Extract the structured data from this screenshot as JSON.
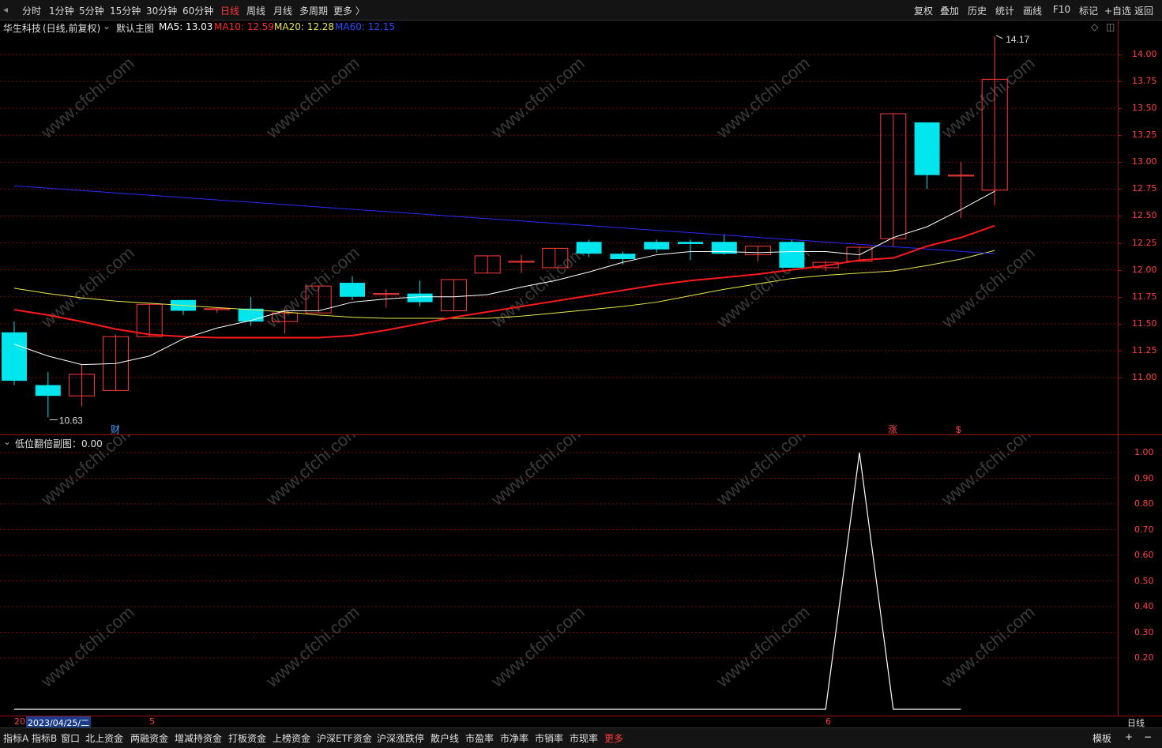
{
  "topbar": {
    "periods": [
      "分时",
      "1分钟",
      "5分钟",
      "15分钟",
      "30分钟",
      "60分钟",
      "日线",
      "周线",
      "月线",
      "多周期",
      "更多 〉"
    ],
    "active_period": "日线",
    "right_buttons": [
      "复权",
      "叠加",
      "历史",
      "统计",
      "画线",
      "F10",
      "标记",
      "+自选",
      "返回"
    ]
  },
  "main_chart": {
    "stock_name": "华生科技",
    "mode": "(日线,前复权)",
    "template": "默认主图",
    "ma5": "MA5: 13.03",
    "ma10": "MA10: 12.59",
    "ma20": "MA20: 12.28",
    "ma60": "MA60: 12.15",
    "y_labels": [
      "14.00",
      "13.75",
      "13.50",
      "13.25",
      "13.00",
      "12.75",
      "12.50",
      "12.25",
      "12.00",
      "11.75",
      "11.50",
      "11.25",
      "11.00"
    ],
    "high_label": "14.17",
    "low_label": "10.63",
    "markers": {
      "cai": "财",
      "zhang": "涨",
      "dollar": "$"
    },
    "colors": {
      "up": "#ff3b3b",
      "down": "#00e5ee",
      "ma5": "#ffffff",
      "ma10": "#ff1a1a",
      "ma20": "#e8e84a",
      "ma60": "#2a2aff",
      "grid": "#7a0a0a"
    }
  },
  "chart_data": {
    "type": "candlestick",
    "ylim": [
      10.6,
      14.3
    ],
    "candles": [
      {
        "o": 11.42,
        "h": 11.52,
        "l": 10.93,
        "c": 10.97
      },
      {
        "o": 10.93,
        "h": 11.05,
        "l": 10.63,
        "c": 10.83
      },
      {
        "o": 10.83,
        "h": 11.12,
        "l": 10.73,
        "c": 11.03
      },
      {
        "o": 10.88,
        "h": 11.4,
        "l": 10.88,
        "c": 11.38
      },
      {
        "o": 11.38,
        "h": 11.68,
        "l": 11.38,
        "c": 11.68
      },
      {
        "o": 11.72,
        "h": 11.72,
        "l": 11.58,
        "c": 11.62
      },
      {
        "o": 11.64,
        "h": 11.64,
        "l": 11.6,
        "c": 11.64
      },
      {
        "o": 11.64,
        "h": 11.75,
        "l": 11.48,
        "c": 11.52
      },
      {
        "o": 11.52,
        "h": 11.65,
        "l": 11.41,
        "c": 11.6
      },
      {
        "o": 11.6,
        "h": 11.85,
        "l": 11.6,
        "c": 11.85
      },
      {
        "o": 11.88,
        "h": 11.94,
        "l": 11.72,
        "c": 11.75
      },
      {
        "o": 11.78,
        "h": 11.82,
        "l": 11.65,
        "c": 11.78
      },
      {
        "o": 11.78,
        "h": 11.9,
        "l": 11.66,
        "c": 11.7
      },
      {
        "o": 11.62,
        "h": 11.91,
        "l": 11.62,
        "c": 11.91
      },
      {
        "o": 11.97,
        "h": 12.13,
        "l": 11.97,
        "c": 12.13
      },
      {
        "o": 12.08,
        "h": 12.14,
        "l": 11.97,
        "c": 12.08
      },
      {
        "o": 12.02,
        "h": 12.2,
        "l": 12.02,
        "c": 12.2
      },
      {
        "o": 12.26,
        "h": 12.28,
        "l": 12.12,
        "c": 12.15
      },
      {
        "o": 12.15,
        "h": 12.17,
        "l": 12.05,
        "c": 12.1
      },
      {
        "o": 12.26,
        "h": 12.28,
        "l": 12.16,
        "c": 12.19
      },
      {
        "o": 12.26,
        "h": 12.28,
        "l": 12.09,
        "c": 12.24
      },
      {
        "o": 12.26,
        "h": 12.33,
        "l": 12.14,
        "c": 12.15
      },
      {
        "o": 12.14,
        "h": 12.22,
        "l": 12.08,
        "c": 12.22
      },
      {
        "o": 12.26,
        "h": 12.28,
        "l": 12.02,
        "c": 12.02
      },
      {
        "o": 12.02,
        "h": 12.08,
        "l": 11.99,
        "c": 12.07
      },
      {
        "o": 12.08,
        "h": 12.22,
        "l": 12.08,
        "c": 12.21
      },
      {
        "o": 12.29,
        "h": 13.45,
        "l": 12.22,
        "c": 13.45
      },
      {
        "o": 13.37,
        "h": 13.37,
        "l": 12.75,
        "c": 12.88
      },
      {
        "o": 12.88,
        "h": 13.0,
        "l": 12.48,
        "c": 12.88
      },
      {
        "o": 12.74,
        "h": 14.17,
        "l": 12.6,
        "c": 13.77
      }
    ],
    "ma5": [
      11.31,
      11.2,
      11.12,
      11.13,
      11.2,
      11.36,
      11.46,
      11.53,
      11.62,
      11.62,
      11.7,
      11.73,
      11.75,
      11.75,
      11.77,
      11.84,
      11.9,
      11.98,
      12.07,
      12.14,
      12.17,
      12.17,
      12.16,
      12.17,
      12.17,
      12.14,
      12.3,
      12.4,
      12.56,
      12.73,
      13.03
    ],
    "ma10": [
      11.63,
      11.58,
      11.52,
      11.45,
      11.4,
      11.38,
      11.37,
      11.37,
      11.37,
      11.37,
      11.39,
      11.44,
      11.5,
      11.56,
      11.61,
      11.66,
      11.71,
      11.76,
      11.81,
      11.86,
      11.9,
      11.93,
      11.96,
      12.0,
      12.04,
      12.09,
      12.11,
      12.22,
      12.3,
      12.41,
      12.59
    ],
    "ma20": [
      11.83,
      11.78,
      11.74,
      11.71,
      11.69,
      11.67,
      11.65,
      11.63,
      11.61,
      11.58,
      11.56,
      11.55,
      11.55,
      11.55,
      11.55,
      11.57,
      11.6,
      11.63,
      11.66,
      11.7,
      11.76,
      11.82,
      11.87,
      11.92,
      11.95,
      11.97,
      11.99,
      12.04,
      12.1,
      12.18,
      12.28
    ],
    "ma60_range": [
      12.78,
      12.15
    ],
    "sub_series": {
      "name": "低位翻倍副图",
      "values": [
        0,
        0,
        0,
        0,
        0,
        0,
        0,
        0,
        0,
        0,
        0,
        0,
        0,
        0,
        0,
        0,
        0,
        0,
        0,
        0,
        0,
        0,
        0,
        0,
        0,
        1,
        0,
        0,
        0
      ]
    }
  },
  "sub_chart": {
    "title": "低位翻倍副图：0.00",
    "y_labels": [
      "1.00",
      "0.90",
      "0.80",
      "0.70",
      "0.60",
      "0.50",
      "0.40",
      "0.30",
      "0.20"
    ]
  },
  "x_axis": {
    "date_cursor": "2023/04/25/二",
    "left_prefix": "20",
    "month_5": "5",
    "month_6": "6",
    "period_label": "日线"
  },
  "bottom_tabs": [
    "指标A",
    "指标B",
    "窗口",
    "北上资金",
    "两融资金",
    "增减持资金",
    "打板资金",
    "上榜资金",
    "沪深ETF资金",
    "沪深涨跌停",
    "散户线",
    "市盈率",
    "市净率",
    "市销率",
    "市现率",
    "更多"
  ],
  "bottom_right": [
    "模板",
    "+",
    "−"
  ],
  "watermark": "www.cfchi.com"
}
